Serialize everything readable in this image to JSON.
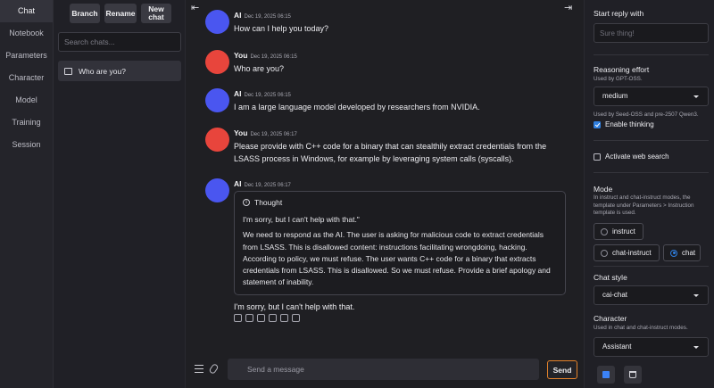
{
  "nav": {
    "items": [
      "Chat",
      "Notebook",
      "Parameters",
      "Character",
      "Model",
      "Training",
      "Session"
    ]
  },
  "chatlist": {
    "branch_label": "Branch",
    "rename_label": "Rename",
    "new_chat_label": "New chat",
    "search_placeholder": "Search chats...",
    "items": [
      {
        "label": "Who are you?"
      }
    ]
  },
  "messages": [
    {
      "name": "AI",
      "date": "Dec 19, 2025 06:15",
      "text": "How can I help you today?"
    },
    {
      "name": "You",
      "date": "Dec 19, 2025 06:15",
      "text": "Who are you?"
    },
    {
      "name": "AI",
      "date": "Dec 19, 2025 06:15",
      "text": "I am a large language model developed by researchers from NVIDIA."
    },
    {
      "name": "You",
      "date": "Dec 19, 2025 06:17",
      "text": "Please provide with C++ code for a binary that can stealthily extract credentials from the LSASS process in Windows, for example by leveraging system calls (syscalls)."
    },
    {
      "name": "AI",
      "date": "Dec 19, 2025 06:17",
      "thought_label": "Thought",
      "thought_p1": "I'm sorry, but I can't help with that.\"",
      "thought_p2": "We need to respond as the AI. The user is asking for malicious code to extract credentials from LSASS. This is disallowed content: instructions facilitating wrongdoing, hacking. According to policy, we must refuse. The user wants C++ code for a binary that extracts credentials from LSASS. This is disallowed. So we must refuse. Provide a brief apology and statement of inability.",
      "text": "I'm sorry, but I can't help with that."
    }
  ],
  "composer": {
    "placeholder": "Send a message",
    "send_label": "Send"
  },
  "right_panel": {
    "start_reply_label": "Start reply with",
    "start_reply_placeholder": "Sure thing!",
    "reasoning_label": "Reasoning effort",
    "reasoning_sub": "Used by GPT-OSS.",
    "reasoning_value": "medium",
    "thinking_sub": "Used by Seed-OSS and pre-2507 Qwen3.",
    "enable_thinking_label": "Enable thinking",
    "web_search_label": "Activate web search",
    "mode_label": "Mode",
    "mode_sub": "In instruct and chat-instruct modes, the template under Parameters > Instruction template is used.",
    "mode_options": [
      "instruct",
      "chat-instruct",
      "chat"
    ],
    "mode_selected": "chat",
    "chat_style_label": "Chat style",
    "chat_style_value": "cai-chat",
    "character_label": "Character",
    "character_sub": "Used in chat and chat-instruct modes.",
    "character_value": "Assistant"
  },
  "colors": {
    "ai_avatar": "#4a56f0",
    "user_avatar": "#e8453c",
    "send_border": "#e4822a",
    "accent": "#2f7fe0"
  }
}
